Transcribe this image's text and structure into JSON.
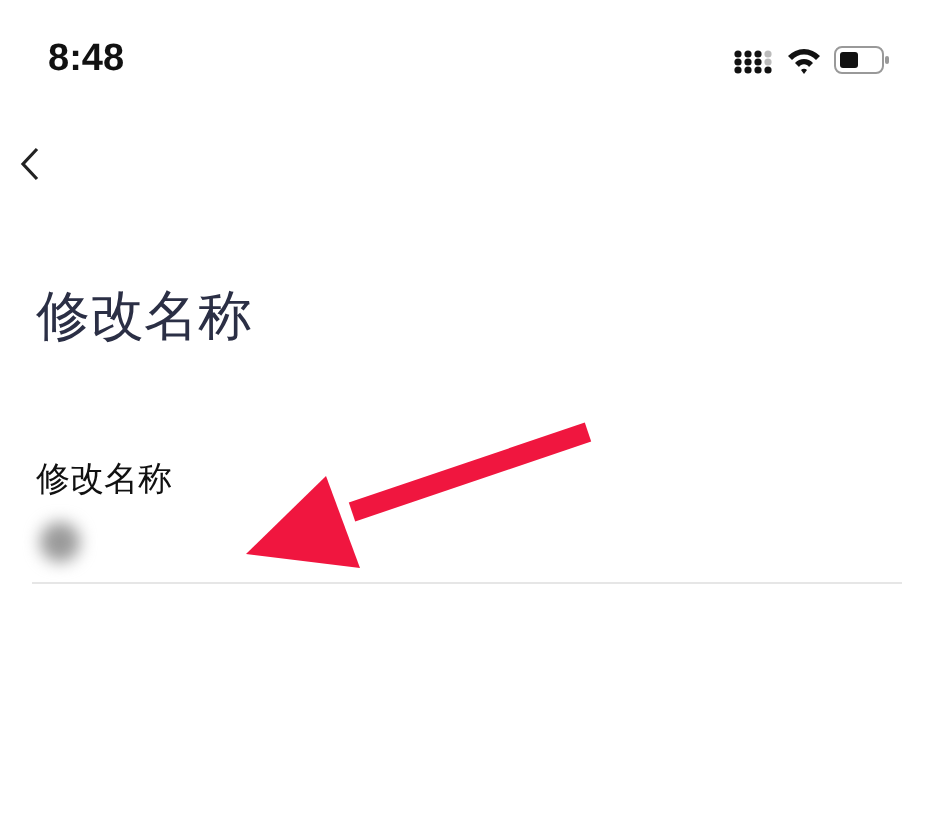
{
  "status_bar": {
    "time": "8:48"
  },
  "page": {
    "title": "修改名称"
  },
  "field": {
    "label": "修改名称"
  }
}
